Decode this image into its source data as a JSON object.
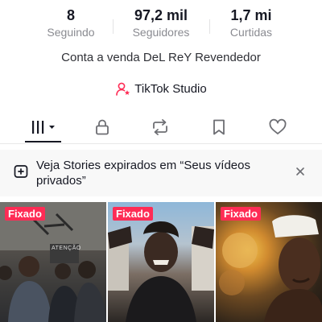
{
  "stats": [
    {
      "value": "8",
      "label": "Seguindo"
    },
    {
      "value": "97,2 mil",
      "label": "Seguidores"
    },
    {
      "value": "1,7 mi",
      "label": "Curtidas"
    }
  ],
  "bio": "Conta a venda DeL ReY Revendedor",
  "studio": {
    "label": "TikTok Studio",
    "icon": "person-star-icon"
  },
  "tabs": [
    {
      "name": "videos-grid",
      "icon": "grid-bars-icon",
      "active": true
    },
    {
      "name": "private",
      "icon": "lock-icon"
    },
    {
      "name": "reposts",
      "icon": "repost-icon"
    },
    {
      "name": "favorites",
      "icon": "bookmark-icon"
    },
    {
      "name": "liked",
      "icon": "heart-icon"
    }
  ],
  "banner": {
    "text": "Veja Stories expirados em “Seus vídeos privados”",
    "icon": "add-story-icon",
    "close_icon": "close-icon"
  },
  "videos": [
    {
      "pinned_label": "Fixado",
      "image_text": "ATENÇÃO"
    },
    {
      "pinned_label": "Fixado"
    },
    {
      "pinned_label": "Fixado"
    }
  ],
  "colors": {
    "accent": "#fe2c55",
    "text": "#161823",
    "muted": "#8a8b91"
  }
}
